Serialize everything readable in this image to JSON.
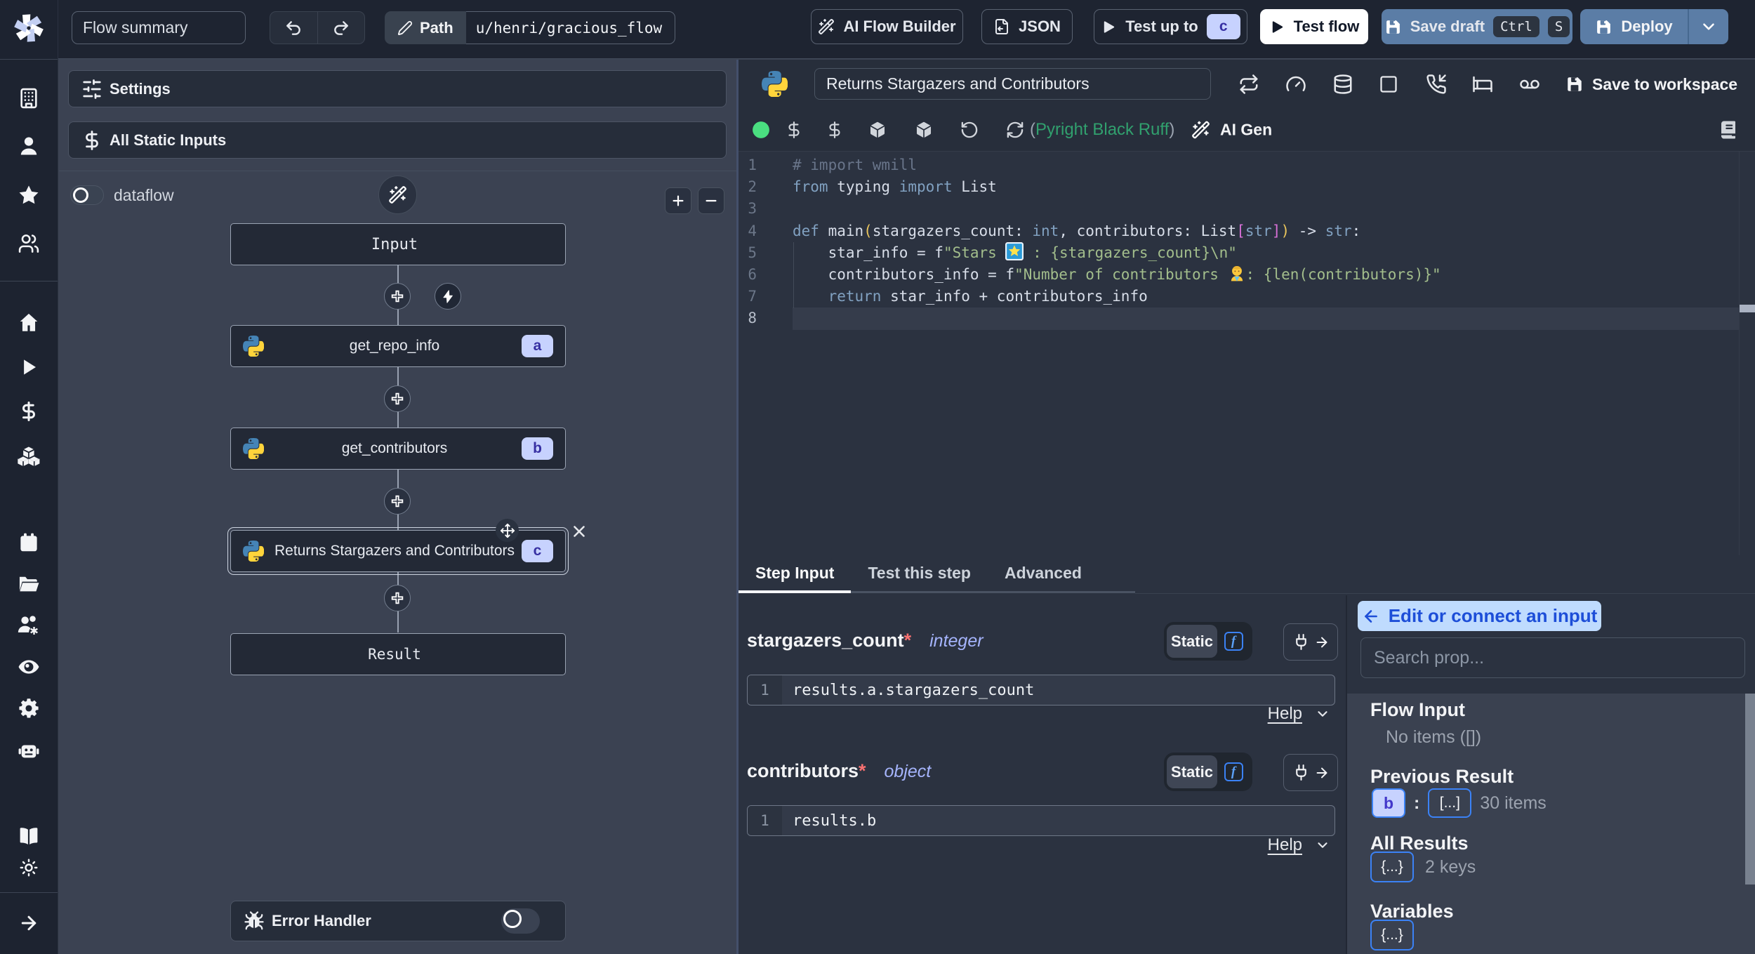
{
  "palette": {
    "sidebar_bg": "#1d2330",
    "topbar_bg": "#1e2431",
    "flow_bg": "#3b4252",
    "panel_bg": "#2b3240",
    "box_bg": "#262d3a",
    "node_bg": "#232936",
    "accent_blue": "#3b82f6",
    "button_blue": "#5b7da6",
    "badge_bg": "#c7d2fe",
    "badge_text": "#3730a3",
    "green_dot": "#4ade80",
    "lint_green": "#31a06e",
    "code_keyword": "#81a1c1",
    "code_string": "#a3be8c",
    "code_comment": "#69758a",
    "code_bracket1": "#e9c55c",
    "code_bracket2": "#d670d6",
    "edit_connect_bg": "#bfdbfe",
    "edit_connect_text": "#1d4ed8",
    "light_panel": "#3a4150"
  },
  "topbar": {
    "flow_summary": "Flow summary",
    "path_label": "Path",
    "path_value": "u/henri/gracious_flow",
    "ai_flow_builder": "AI Flow Builder",
    "json": "JSON",
    "test_up_to": "Test up to",
    "test_up_to_badge": "c",
    "test_flow": "Test flow",
    "save_draft": "Save draft",
    "kbd_ctrl": "Ctrl",
    "kbd_s": "S",
    "deploy": "Deploy"
  },
  "flow": {
    "settings": "Settings",
    "all_static_inputs": "All Static Inputs",
    "dataflow": "dataflow",
    "nodes": {
      "input": "Input",
      "a": {
        "label": "get_repo_info",
        "badge": "a"
      },
      "b": {
        "label": "get_contributors",
        "badge": "b"
      },
      "c": {
        "label": "Returns Stargazers and Contributors",
        "badge": "c"
      },
      "result": "Result"
    },
    "error_handler": "Error Handler"
  },
  "header": {
    "title_value": "Returns Stargazers and Contributors",
    "save_to_workspace": "Save to workspace"
  },
  "toolbar": {
    "lint_open": "(",
    "lint_words": "Pyright Black Ruff",
    "lint_close": ")",
    "ai_gen": "AI Gen"
  },
  "editor": {
    "lines": [
      {
        "n": "1",
        "tokens": [
          {
            "t": "# import wmill",
            "c": "c"
          }
        ]
      },
      {
        "n": "2",
        "tokens": [
          {
            "t": "from",
            "c": "k"
          },
          {
            "t": " typing ",
            "c": "p"
          },
          {
            "t": "import",
            "c": "k"
          },
          {
            "t": " List",
            "c": "p"
          }
        ]
      },
      {
        "n": "3",
        "tokens": []
      },
      {
        "n": "4",
        "tokens": [
          {
            "t": "def",
            "c": "k"
          },
          {
            "t": " main",
            "c": "p"
          },
          {
            "t": "(",
            "c": "b1"
          },
          {
            "t": "stargazers_count: ",
            "c": "p"
          },
          {
            "t": "int",
            "c": "k"
          },
          {
            "t": ", contributors: List",
            "c": "p"
          },
          {
            "t": "[",
            "c": "b2"
          },
          {
            "t": "str",
            "c": "k"
          },
          {
            "t": "]",
            "c": "b2"
          },
          {
            "t": ")",
            "c": "b1"
          },
          {
            "t": " -> ",
            "c": "p"
          },
          {
            "t": "str",
            "c": "k"
          },
          {
            "t": ":",
            "c": "p"
          }
        ]
      },
      {
        "n": "5",
        "tokens": [
          {
            "t": "    star_info = f",
            "c": "p"
          },
          {
            "t": "\"Stars ",
            "c": "s"
          },
          {
            "emoji": "shooting-star"
          },
          {
            "t": " : {stargazers_count}\\n\"",
            "c": "s"
          }
        ]
      },
      {
        "n": "6",
        "tokens": [
          {
            "t": "    contributors_info = f",
            "c": "p"
          },
          {
            "t": "\"Number of contributors ",
            "c": "s"
          },
          {
            "emoji": "person"
          },
          {
            "t": ": {len(contributors)}\"",
            "c": "s"
          }
        ]
      },
      {
        "n": "7",
        "tokens": [
          {
            "t": "    ",
            "c": "p"
          },
          {
            "t": "return",
            "c": "k"
          },
          {
            "t": " star_info + contributors_info",
            "c": "p"
          }
        ]
      },
      {
        "n": "8",
        "tokens": []
      }
    ],
    "active_line": 8
  },
  "tabs": {
    "items": [
      "Step Input",
      "Test this step",
      "Advanced"
    ],
    "active": 0
  },
  "step_input": {
    "fields": [
      {
        "name": "stargazers_count",
        "required": "*",
        "type": "integer",
        "mode": "Static",
        "expr_line": "1",
        "expr": "results.a.stargazers_count",
        "help": "Help"
      },
      {
        "name": "contributors",
        "required": "*",
        "type": "object",
        "mode": "Static",
        "expr_line": "1",
        "expr": "results.b",
        "help": "Help"
      }
    ]
  },
  "context": {
    "edit_connect": "Edit or connect an input",
    "search_placeholder": "Search prop...",
    "flow_input": "Flow Input",
    "no_items": "No items ([])",
    "previous_result": "Previous Result",
    "prev_key": "b",
    "prev_colon": ":",
    "prev_val": "[...]",
    "prev_count": "30 items",
    "all_results": "All Results",
    "all_val": "{...}",
    "all_count": "2 keys",
    "variables": "Variables",
    "vars_val": "{...}"
  }
}
